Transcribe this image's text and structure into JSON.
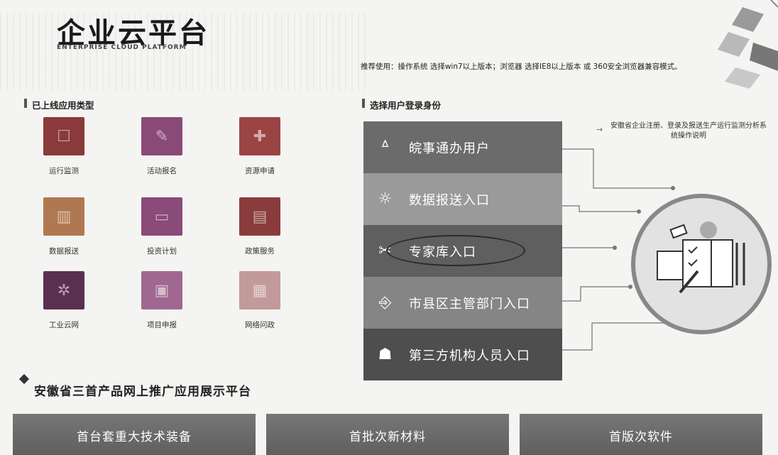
{
  "header": {
    "title": "企业云平台",
    "subtitle": "ENTERPRISE CLOUD PLATFORM",
    "recommend": "推荐使用：操作系统 选择win7以上版本；浏览器 选择IE8以上版本 或 360安全浏览器兼容模式。"
  },
  "apps_section": {
    "heading": "已上线应用类型",
    "items": [
      {
        "label": "运行监测",
        "icon": "monitor-icon",
        "color": "#8a3a3a",
        "glyph": "☐"
      },
      {
        "label": "活动报名",
        "icon": "signup-icon",
        "color": "#8a4a78",
        "glyph": "✎"
      },
      {
        "label": "资源申请",
        "icon": "resource-icon",
        "color": "#9a4444",
        "glyph": "✚"
      },
      {
        "label": "数据报送",
        "icon": "data-report-icon",
        "color": "#b07850",
        "glyph": "▥"
      },
      {
        "label": "投资计划",
        "icon": "invest-plan-icon",
        "color": "#8a4a7a",
        "glyph": "▭"
      },
      {
        "label": "政策服务",
        "icon": "policy-icon",
        "color": "#8a3c3c",
        "glyph": "▤"
      },
      {
        "label": "工业云网",
        "icon": "cloud-network-icon",
        "color": "#5a3050",
        "glyph": "✲"
      },
      {
        "label": "项目申报",
        "icon": "project-apply-icon",
        "color": "#a06890",
        "glyph": "▣"
      },
      {
        "label": "网络问政",
        "icon": "online-gov-icon",
        "color": "#c39a9a",
        "glyph": "▦"
      }
    ]
  },
  "login_section": {
    "heading": "选择用户登录身份",
    "items": [
      {
        "label": "皖事通办用户",
        "icon": "wanshitong-icon",
        "color": "#6b6b6b",
        "glyph": "ᐞ"
      },
      {
        "label": "数据报送入口",
        "icon": "data-report-sun-icon",
        "color": "#9a9a9a",
        "glyph": "☼"
      },
      {
        "label": "专家库入口",
        "icon": "expert-icon",
        "color": "#5f5f5f",
        "glyph": "✂"
      },
      {
        "label": "市县区主管部门入口",
        "icon": "department-door-icon",
        "color": "#858585",
        "glyph": "⎆"
      },
      {
        "label": "第三方机构人员入口",
        "icon": "third-party-users-icon",
        "color": "#4e4e4e",
        "glyph": "☗"
      }
    ],
    "help_text": "安徽省企业注册、登录及报送生产运行监测分析系统操作说明"
  },
  "promo": {
    "title": "安徽省三首产品网上推广应用展示平台",
    "buttons": [
      "首台套重大技术装备",
      "首批次新材料",
      "首版次软件"
    ]
  }
}
